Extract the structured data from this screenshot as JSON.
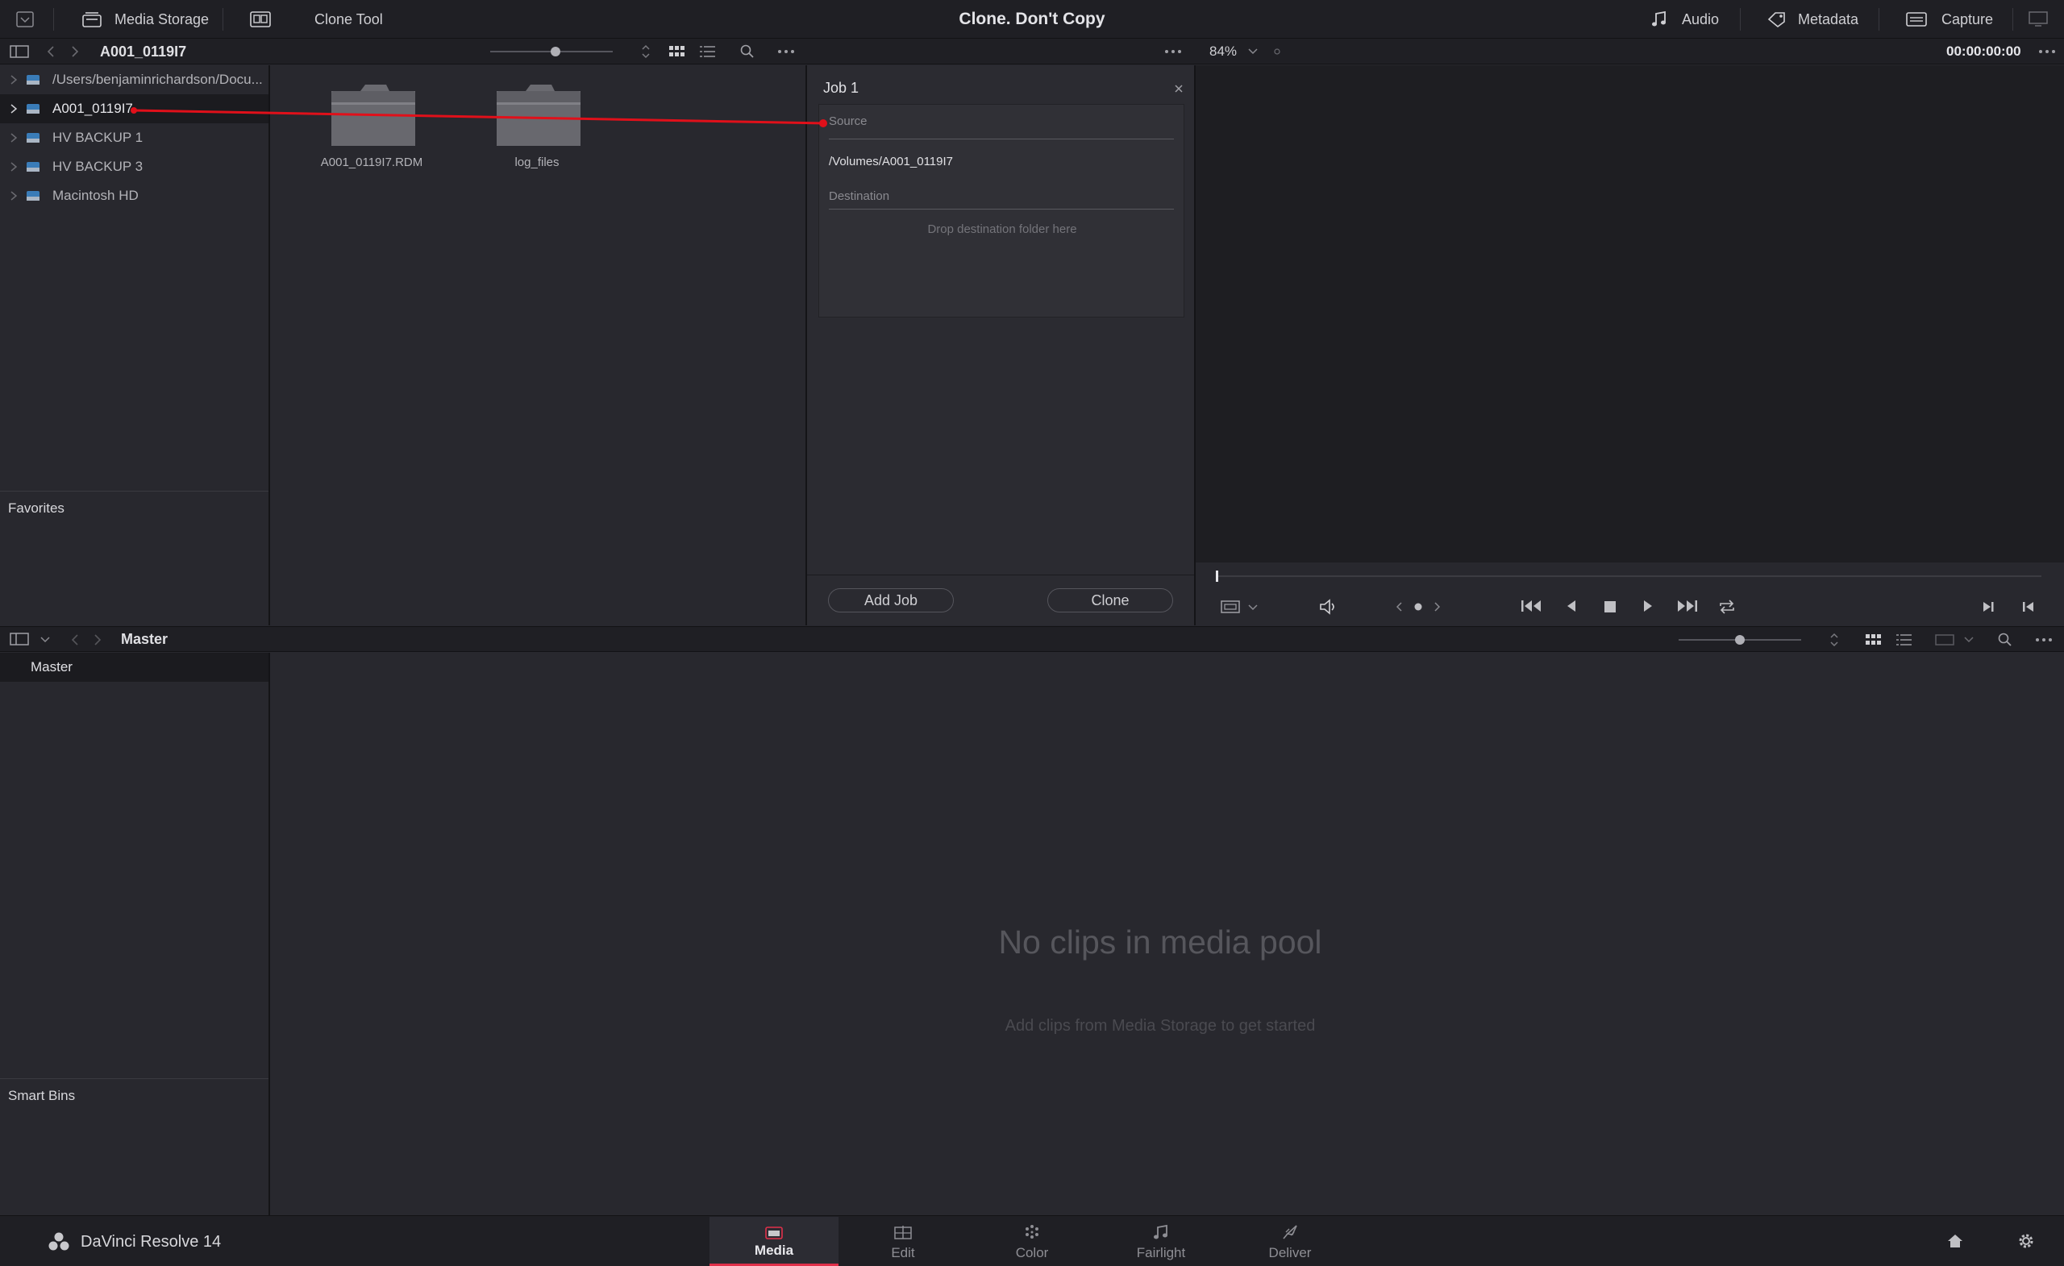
{
  "app": {
    "window_title": "Clone. Don't Copy",
    "brand_name": "DaVinci Resolve 14"
  },
  "top_bar": {
    "media_storage_label": "Media Storage",
    "clone_tool_label": "Clone Tool",
    "audio_label": "Audio",
    "metadata_label": "Metadata",
    "capture_label": "Capture"
  },
  "storage_browser": {
    "current_path": "A001_0119I7",
    "tree": [
      {
        "label": "/Users/benjaminrichardson/Docu...",
        "selected": false
      },
      {
        "label": "A001_0119I7",
        "selected": true
      },
      {
        "label": "HV BACKUP 1",
        "selected": false
      },
      {
        "label": "HV BACKUP 3",
        "selected": false
      },
      {
        "label": "Macintosh HD",
        "selected": false
      }
    ],
    "favorites_title": "Favorites",
    "items": [
      {
        "name": "A001_0119I7.RDM",
        "icon": "folder-icon"
      },
      {
        "name": "log_files",
        "icon": "folder-icon"
      }
    ]
  },
  "clone_tool": {
    "job_title": "Job 1",
    "source_label": "Source",
    "source_value": "/Volumes/A001_0119I7",
    "destination_label": "Destination",
    "destination_placeholder": "Drop destination folder here",
    "add_job_label": "Add Job",
    "clone_label": "Clone"
  },
  "viewer": {
    "zoom": "84%",
    "timecode": "00:00:00:00"
  },
  "media_pool": {
    "bin_title": "Master",
    "bins": [
      {
        "label": "Master"
      }
    ],
    "smart_bins_title": "Smart Bins",
    "empty_title": "No clips in media pool",
    "empty_subtitle": "Add clips from Media Storage to get started"
  },
  "pages": [
    {
      "label": "Media",
      "icon": "media-page-icon",
      "active": true
    },
    {
      "label": "Edit",
      "icon": "edit-page-icon",
      "active": false
    },
    {
      "label": "Color",
      "icon": "color-page-icon",
      "active": false
    },
    {
      "label": "Fairlight",
      "icon": "fairlight-page-icon",
      "active": false
    },
    {
      "label": "Deliver",
      "icon": "deliver-page-icon",
      "active": false
    }
  ],
  "colors": {
    "accent_red": "#e0304a",
    "drag_line": "#e0101a",
    "drive_blue": "#4a9ad8"
  }
}
